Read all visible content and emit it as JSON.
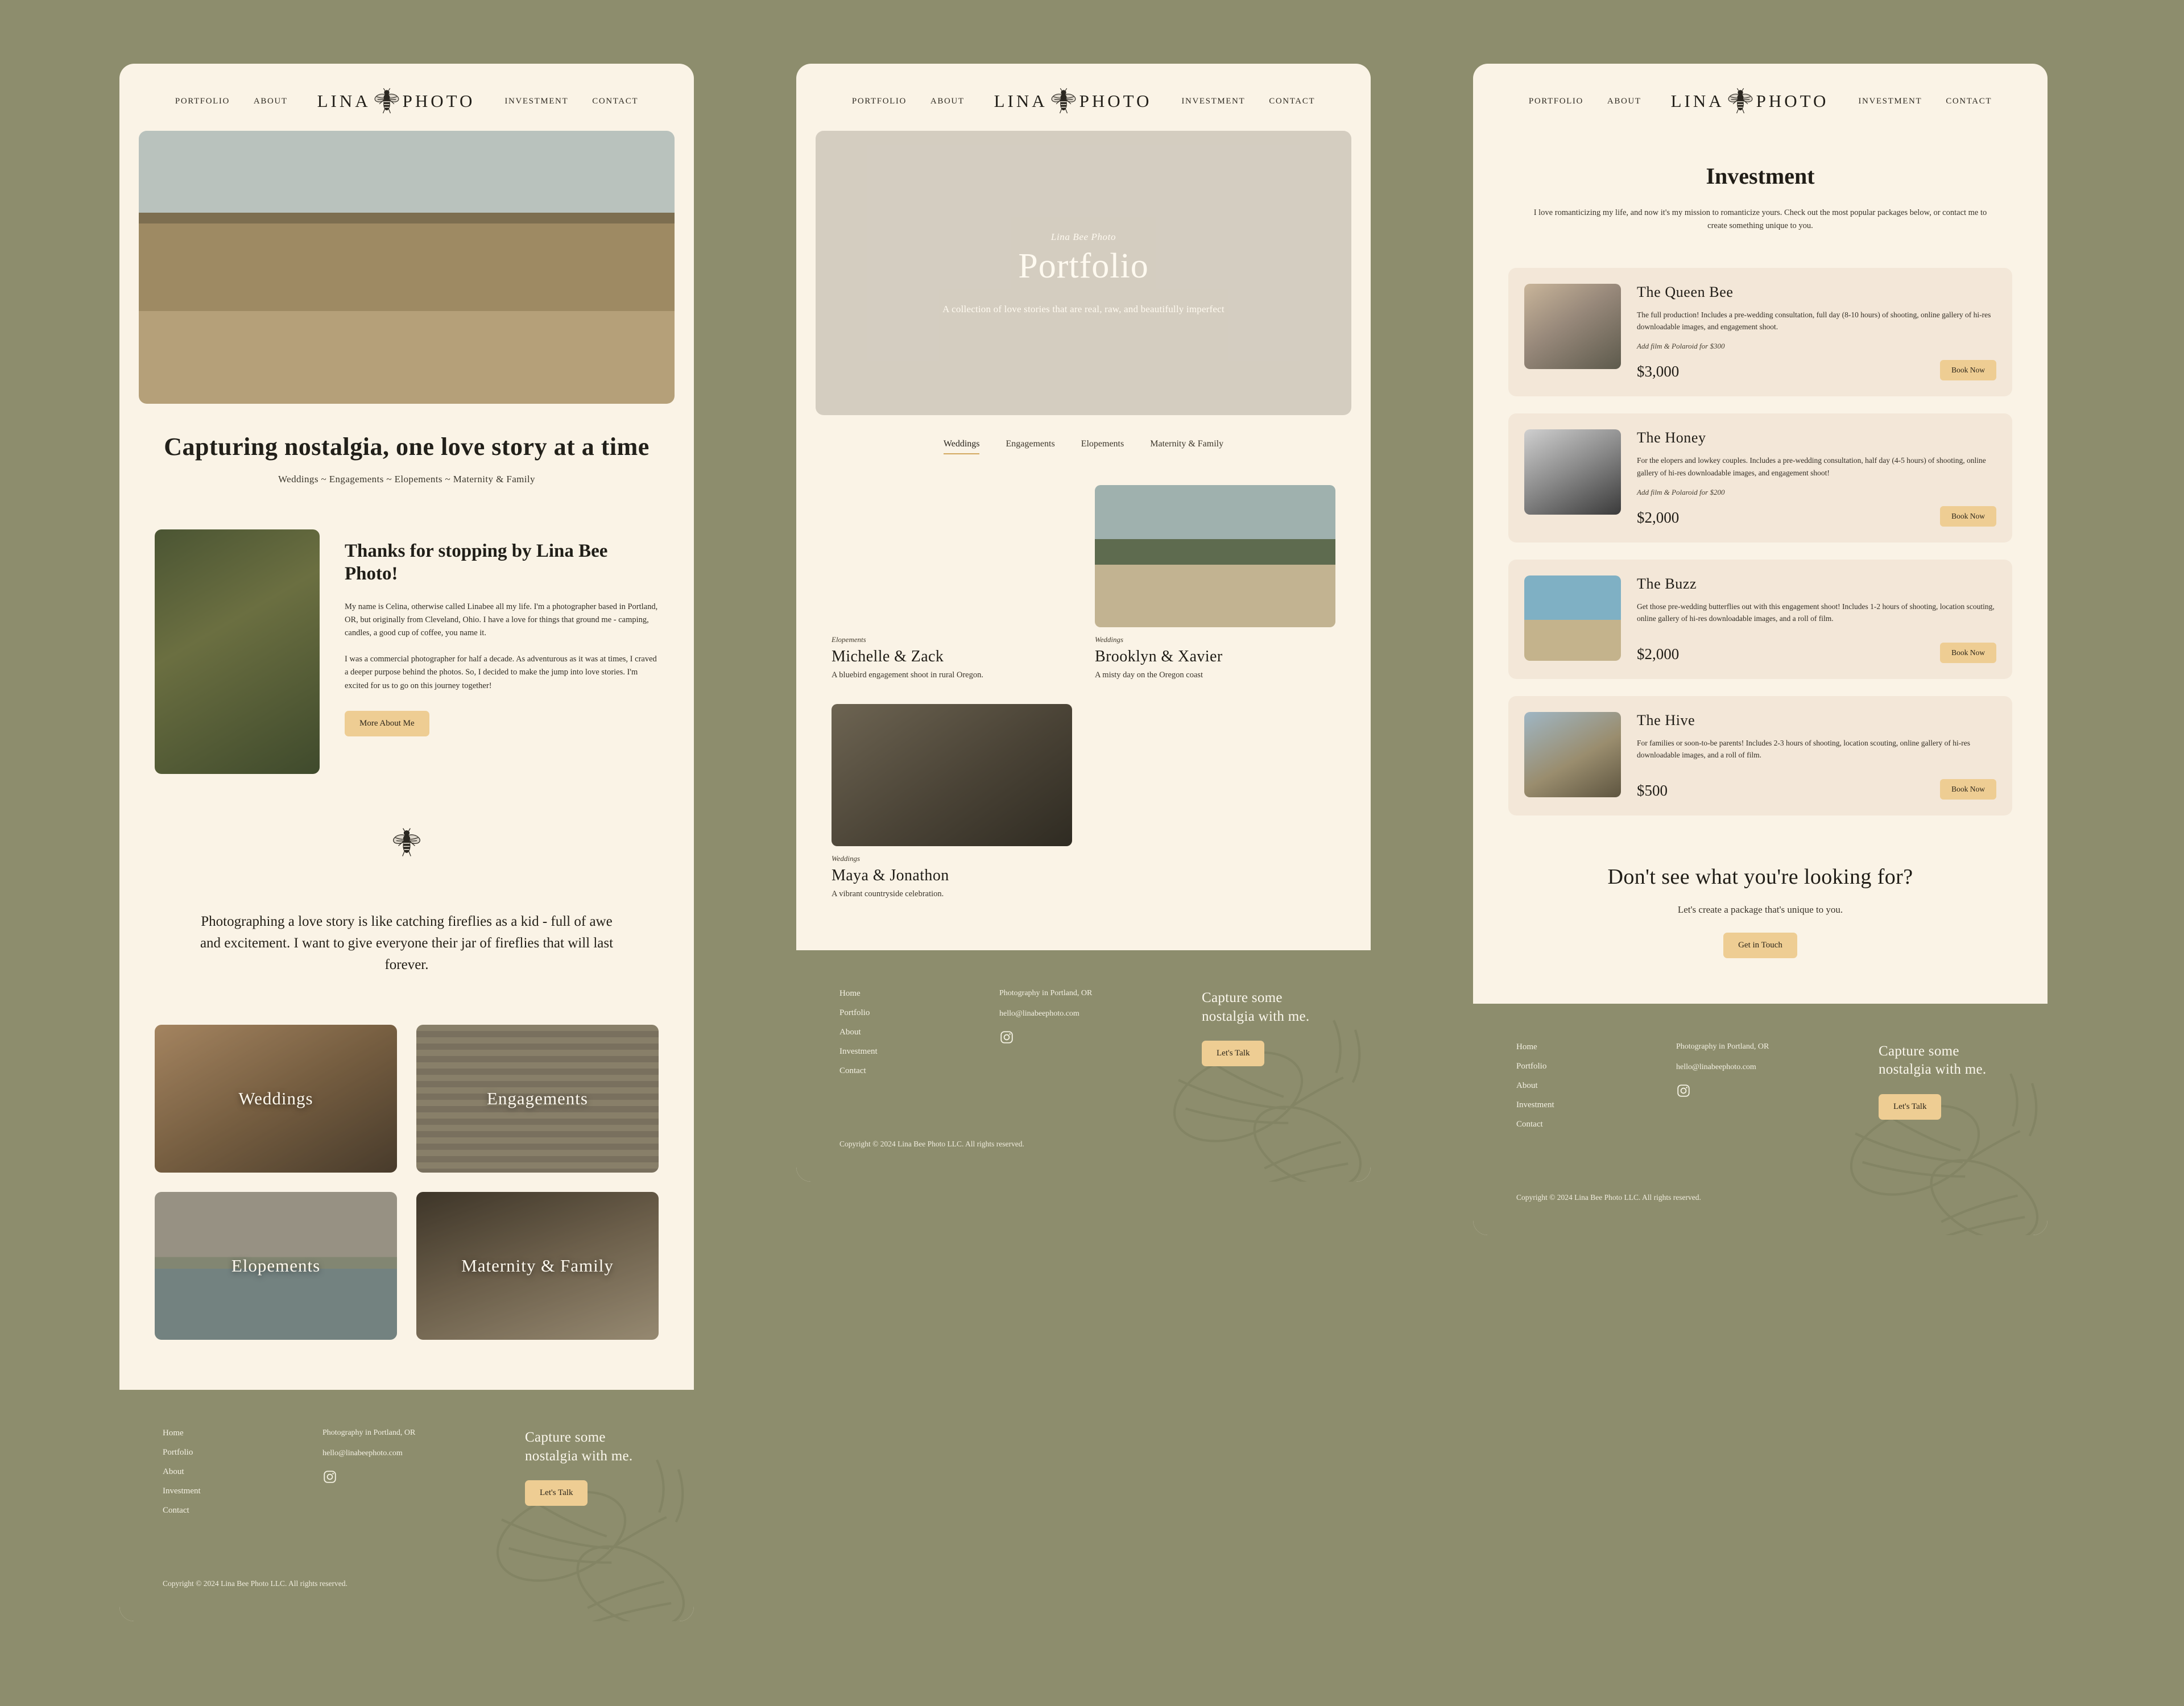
{
  "brand": {
    "word1": "LINA",
    "word2": "PHOTO",
    "logo_icon": "bee-logo-icon"
  },
  "nav": {
    "left": [
      {
        "label": "PORTFOLIO"
      },
      {
        "label": "ABOUT"
      }
    ],
    "right": [
      {
        "label": "INVESTMENT"
      },
      {
        "label": "CONTACT"
      }
    ]
  },
  "home": {
    "headline": "Capturing nostalgia, one love story at a time",
    "subline": "Weddings  ~  Engagements  ~  Elopements  ~  Maternity & Family",
    "about": {
      "title": "Thanks for stopping by Lina Bee Photo!",
      "para1": "My name is Celina, otherwise called Linabee all my life. I'm a photographer based in Portland, OR, but originally from Cleveland, Ohio. I have a love for things that ground me - camping, candles, a good cup of coffee, you name it.",
      "para2": "I was a commercial photographer for half a decade. As adventurous as it was at times, I craved a deeper purpose behind the photos. So, I decided to make the jump into love stories. I'm excited for us to go on this journey together!",
      "button": "More About Me"
    },
    "quote": "Photographing a love story is like catching fireflies as a kid - full of awe and excitement. I want to give everyone their jar of fireflies that will last forever.",
    "tiles": [
      {
        "label": "Weddings"
      },
      {
        "label": "Engagements"
      },
      {
        "label": "Elopements"
      },
      {
        "label": "Maternity & Family"
      }
    ]
  },
  "portfolio": {
    "hero_kicker": "Lina Bee Photo",
    "hero_title": "Portfolio",
    "hero_sub": "A collection of love stories that are real, raw, and beautifully imperfect",
    "filters": [
      {
        "label": "Weddings",
        "active": true
      },
      {
        "label": "Engagements",
        "active": false
      },
      {
        "label": "Elopements",
        "active": false
      },
      {
        "label": "Maternity & Family",
        "active": false
      }
    ],
    "items": [
      {
        "category": "Elopements",
        "name": "Michelle & Zack",
        "desc": "A bluebird engagement shoot in rural Oregon."
      },
      {
        "category": "Weddings",
        "name": "Brooklyn  &  Xavier",
        "desc": "A misty day on the Oregon coast"
      },
      {
        "category": "Weddings",
        "name": "Maya & Jonathon",
        "desc": "A vibrant countryside celebration."
      }
    ]
  },
  "investment": {
    "title": "Investment",
    "intro": "I love romanticizing my life, and now it's my mission to romanticize yours. Check out the most popular packages below, or contact me to create something unique to you.",
    "packages": [
      {
        "name": "The Queen Bee",
        "desc": "The full production! Includes a pre-wedding consultation, full day (8-10 hours) of shooting, online gallery of hi-res downloadable images, and engagement shoot.",
        "addon": "Add film & Polaroid for $300",
        "price": "$3,000",
        "button": "Book Now"
      },
      {
        "name": "The Honey",
        "desc": "For the elopers and lowkey couples. Includes a pre-wedding consultation, half day (4-5 hours) of shooting, online gallery of hi-res downloadable images, and engagement shoot!",
        "addon": "Add film & Polaroid for $200",
        "price": "$2,000",
        "button": "Book Now"
      },
      {
        "name": "The Buzz",
        "desc": "Get those pre-wedding butterflies out with this engagement shoot! Includes 1-2 hours of shooting, location scouting, online gallery of  hi-res downloadable images, and a roll of film.",
        "addon": "",
        "price": "$2,000",
        "button": "Book Now"
      },
      {
        "name": "The Hive",
        "desc": "For families or soon-to-be parents! Includes 2-3 hours of shooting, location scouting, online gallery of hi-res downloadable images, and a roll of film.",
        "addon": "",
        "price": "$500",
        "button": "Book Now"
      }
    ],
    "cta": {
      "title": "Don't see what you're looking for?",
      "sub": "Let's create a package that's unique to you.",
      "button": "Get in Touch"
    }
  },
  "footer": {
    "nav": [
      {
        "label": "Home"
      },
      {
        "label": "Portfolio"
      },
      {
        "label": "About"
      },
      {
        "label": "Investment"
      },
      {
        "label": "Contact"
      }
    ],
    "location": "Photography in Portland, OR",
    "email": "hello@linabeephoto.com",
    "instagram_icon": "instagram-icon",
    "cta_title": "Capture some nostalgia with me.",
    "cta_button": "Let's Talk",
    "copyright": "Copyright © 2024 Lina Bee Photo LLC. All rights reserved."
  },
  "colors": {
    "page_bg": "#8d8d6d",
    "panel_bg": "#faf3e6",
    "card_bg": "#f3e7d8",
    "accent": "#eecd93",
    "underline": "#d3a960",
    "ink": "#22201a"
  }
}
